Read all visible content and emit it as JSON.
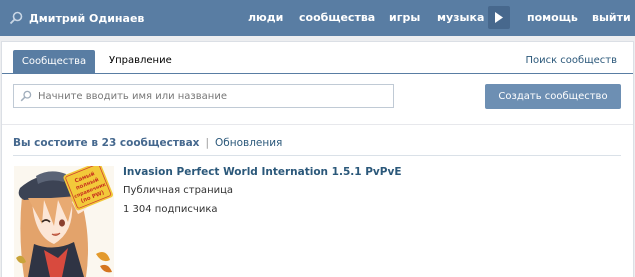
{
  "header": {
    "user_name": "Дмитрий Одинаев",
    "nav": [
      "люди",
      "сообщества",
      "игры",
      "музыка",
      "помощь",
      "выйти"
    ]
  },
  "tabs": {
    "active": "Сообщества",
    "manage": "Управление",
    "search_link": "Поиск сообществ"
  },
  "search": {
    "placeholder": "Начните вводить имя или название",
    "value": ""
  },
  "create_button": "Создать сообщество",
  "summary": {
    "count_text": "Вы состоите в 23 сообществах",
    "separator": "|",
    "updates_link": "Обновления"
  },
  "communities": [
    {
      "name": "Invasion Perfect World Internation 1.5.1 PvPvE",
      "type": "Публичная страница",
      "subscribers": "1 304 подписчика",
      "avatar_badge": "Самый полный справочник (по PW)"
    }
  ],
  "colors": {
    "header_bg": "#597da3",
    "link": "#2b587a",
    "button": "#6d8fb3",
    "page_bg": "#edeef0"
  },
  "icons": {
    "header_search": "magnifier-icon",
    "nav_more": "play-arrow-icon",
    "input_search": "magnifier-icon"
  }
}
